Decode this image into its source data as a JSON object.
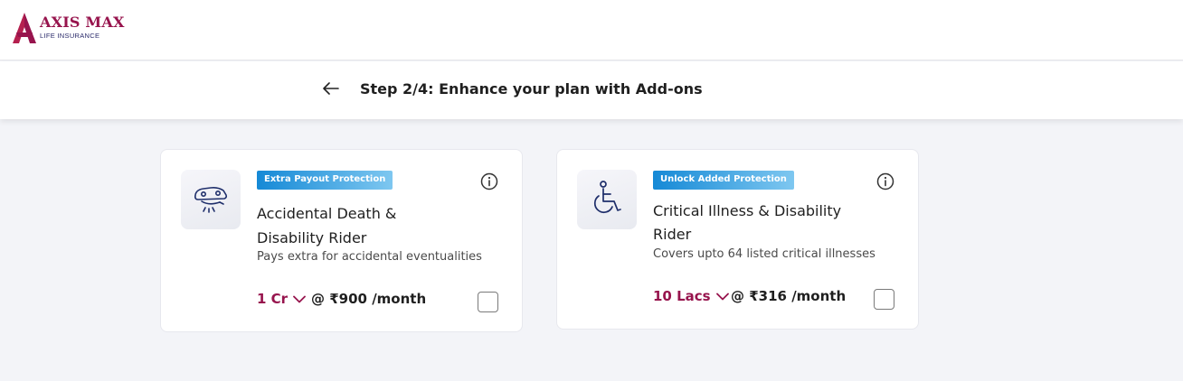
{
  "brand": {
    "name": "AXIS MAX",
    "subtitle": "LIFE INSURANCE",
    "color": "#97144d"
  },
  "step": {
    "title": "Step 2/4: Enhance your plan with Add-ons",
    "back_icon": "arrow-left-icon"
  },
  "addons": [
    {
      "tag": "Extra Payout Protection",
      "icon": "accident-icon",
      "title": "Accidental Death & Disability Rider",
      "description": "Pays extra for accidental eventualities",
      "cover": "1 Cr",
      "price": "@ ₹900 /month",
      "selected": false
    },
    {
      "tag": "Unlock Added Protection",
      "icon": "wheelchair-icon",
      "title": "Critical Illness & Disability Rider",
      "description": "Covers upto 64 listed critical illnesses",
      "cover": "10 Lacs",
      "price": "@ ₹316 /month",
      "selected": false
    }
  ],
  "colors": {
    "accent": "#97144d",
    "tag_gradient_start": "#1589d6",
    "tag_gradient_end": "#7ec7f0",
    "background": "#f3f4f8"
  }
}
